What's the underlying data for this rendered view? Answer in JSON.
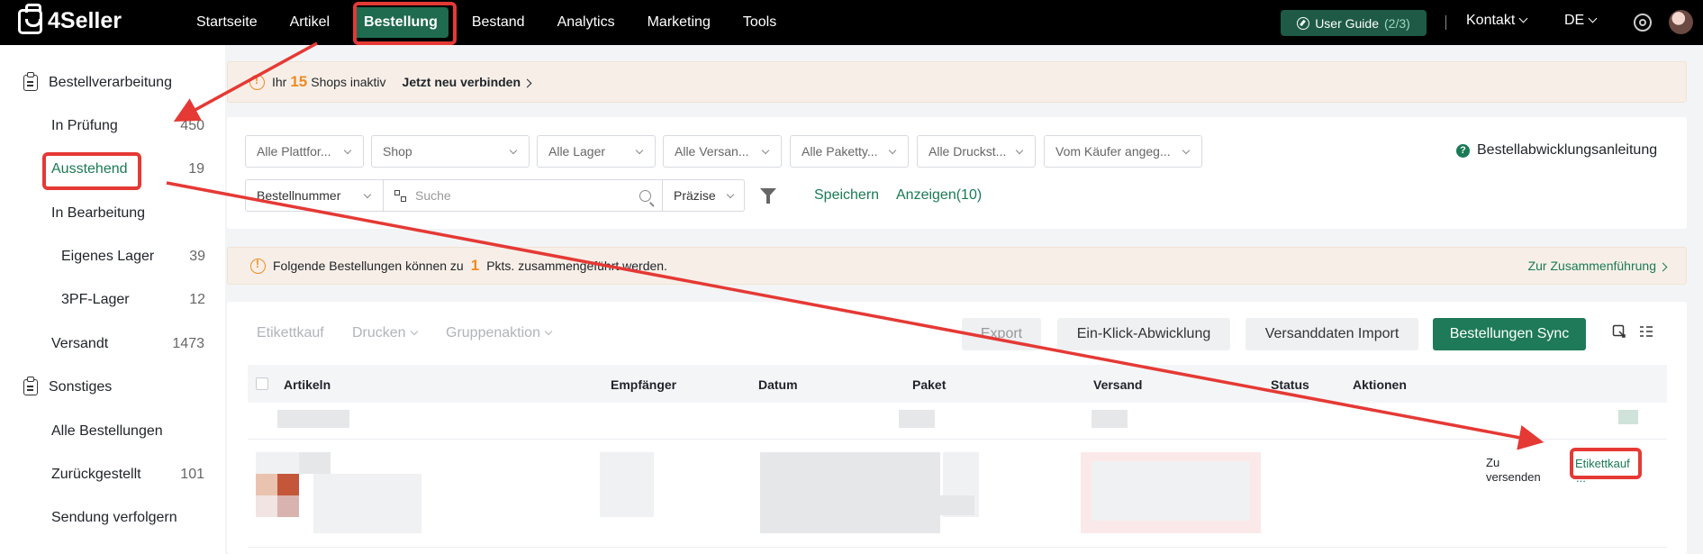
{
  "brand": {
    "name": "4Seller"
  },
  "nav": {
    "items": [
      "Startseite",
      "Artikel",
      "Bestellung",
      "Bestand",
      "Analytics",
      "Marketing",
      "Tools"
    ],
    "active": "Bestellung"
  },
  "topright": {
    "guide_label": "User Guide",
    "guide_count": "(2/3)",
    "contact": "Kontakt",
    "language": "DE"
  },
  "sidebar": {
    "section1": "Bestellverarbeitung",
    "items": [
      {
        "label": "In Prüfung",
        "count": "450"
      },
      {
        "label": "Ausstehend",
        "count": "19"
      },
      {
        "label": "In Bearbeitung",
        "count": ""
      },
      {
        "label": "Eigenes Lager",
        "count": "39"
      },
      {
        "label": "3PF-Lager",
        "count": "12"
      },
      {
        "label": "Versandt",
        "count": "1473"
      }
    ],
    "section2": "Sonstiges",
    "items2": [
      {
        "label": "Alle Bestellungen",
        "count": ""
      },
      {
        "label": "Zurückgestellt",
        "count": "101"
      },
      {
        "label": "Sendung verfolgern",
        "count": ""
      }
    ]
  },
  "banner": {
    "prefix": "Ihr",
    "count": "15",
    "suffix": "Shops inaktiv",
    "link": "Jetzt neu verbinden"
  },
  "filters": {
    "selects": [
      "Alle Plattfor...",
      "Shop",
      "Alle Lager",
      "Alle Versan...",
      "Alle Paketty...",
      "Alle Druckst...",
      "Vom Käufer angeg..."
    ],
    "search_field": "Bestellnummer",
    "search_placeholder": "Suche",
    "match_mode": "Präzise",
    "save": "Speichern",
    "show": "Anzeigen(10)",
    "help": "Bestellabwicklungsanleitung"
  },
  "merge": {
    "prefix": "Folgende Bestellungen können zu",
    "count": "1",
    "suffix": "Pkts. zusammengeführt werden.",
    "link": "Zur Zusammenführung"
  },
  "toolbar": {
    "label_buy": "Etikettkauf",
    "print": "Drucken",
    "group": "Gruppenaktion",
    "export": "Export",
    "one_click": "Ein-Klick-Abwicklung",
    "import": "Versanddaten Import",
    "sync": "Bestellungen Sync"
  },
  "table": {
    "headers": [
      "Artikeln",
      "Empfänger",
      "Datum",
      "Paket",
      "Versand",
      "Status",
      "Aktionen"
    ],
    "row": {
      "status": "Zu versenden",
      "action": "Etikettkauf",
      "more": "..."
    }
  },
  "colors": {
    "accent": "#1a7a55",
    "highlight": "#e53935",
    "warning": "#f08a24"
  }
}
